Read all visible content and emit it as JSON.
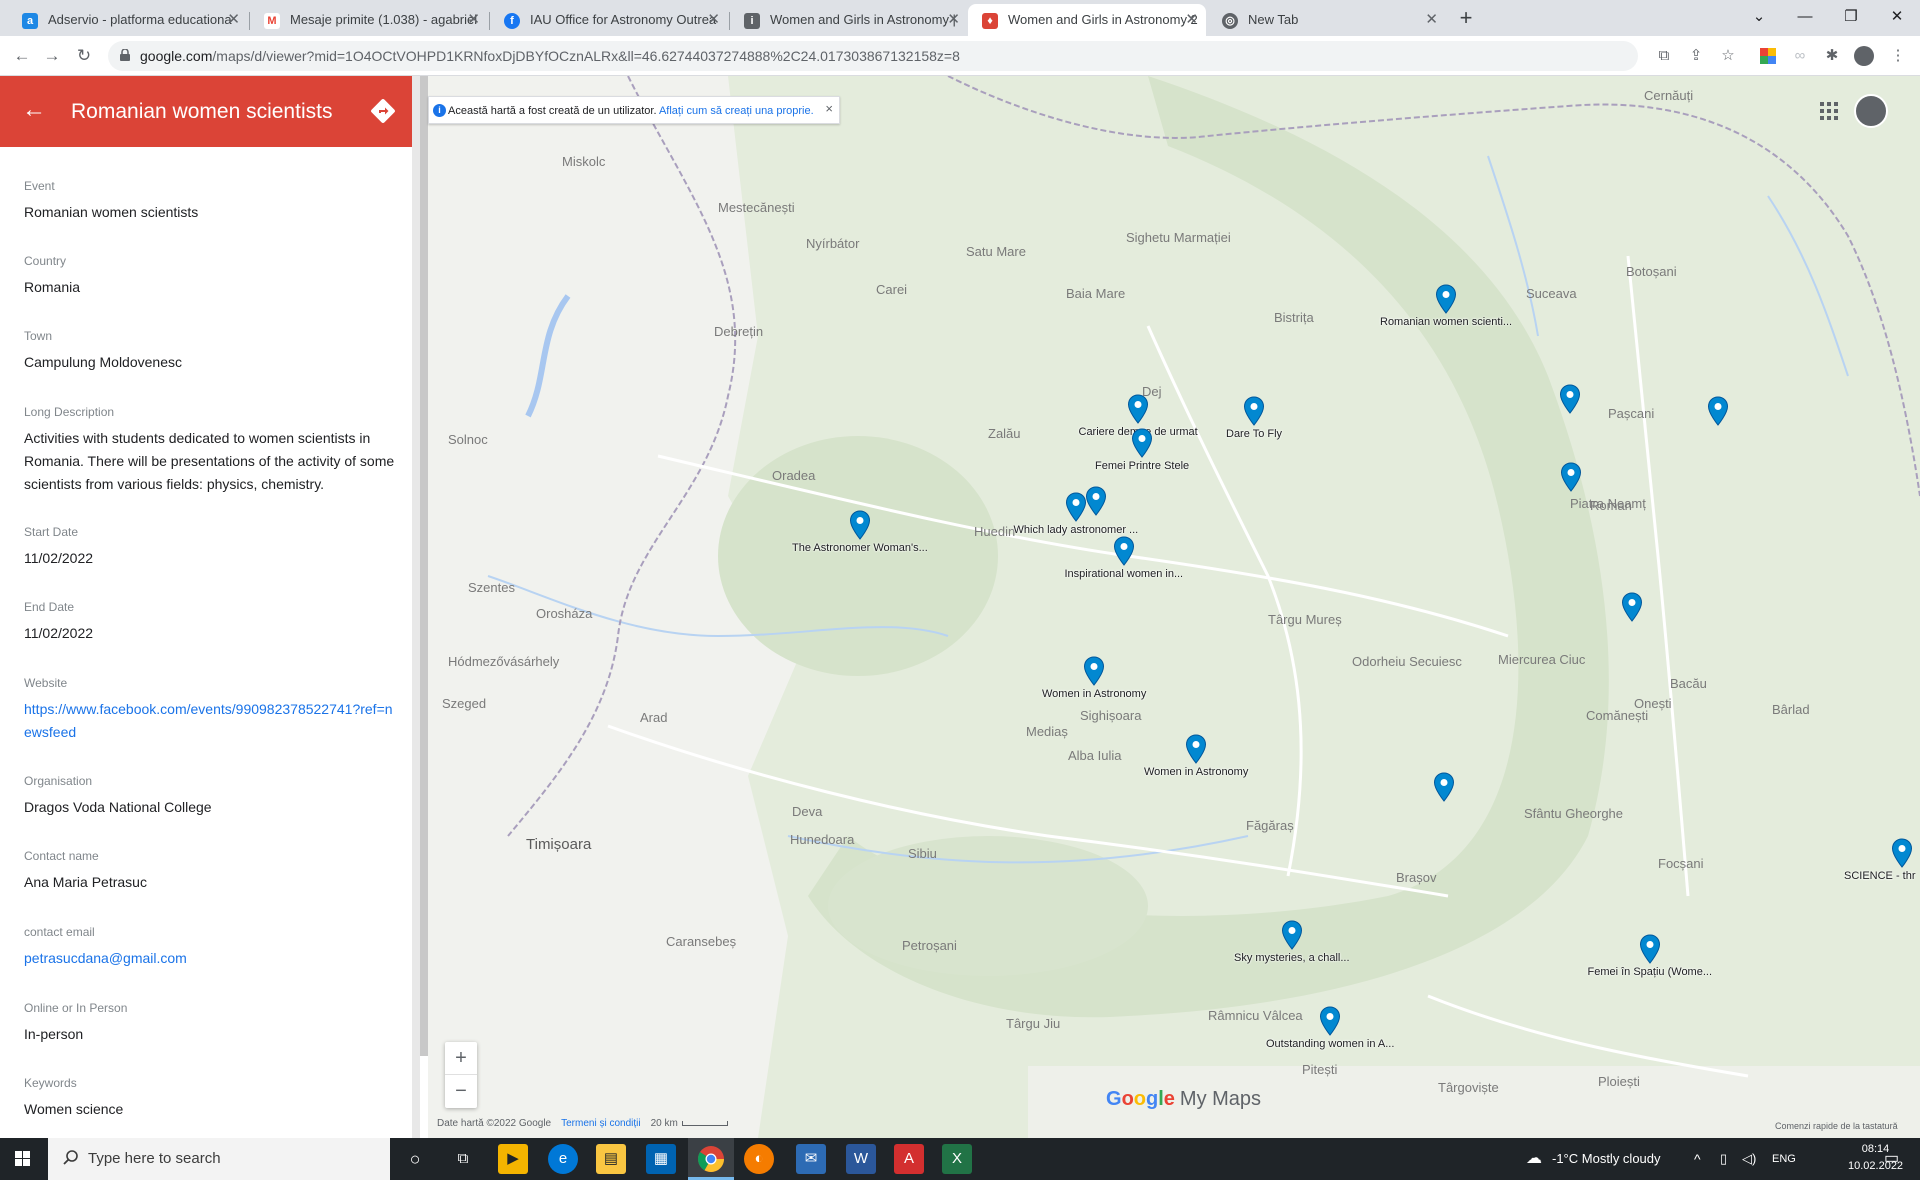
{
  "browser": {
    "tabs": [
      {
        "title": "Adservio - platforma educationa",
        "icon": "adservio-icon",
        "color": "#1e88e5"
      },
      {
        "title": "Mesaje primite (1.038) - agabriel",
        "icon": "gmail-icon",
        "color": "#ea4335"
      },
      {
        "title": "IAU Office for Astronomy Outrea",
        "icon": "facebook-icon",
        "color": "#1877f2"
      },
      {
        "title": "Women and Girls in Astronomy |",
        "icon": "iau-icon",
        "color": "#5f6368"
      },
      {
        "title": "Women and Girls in Astronomy 2",
        "icon": "mymaps-icon",
        "color": "#db4437"
      },
      {
        "title": "New Tab",
        "icon": "chrome-icon",
        "color": "#5f6368"
      }
    ],
    "url_host": "google.com",
    "url_path": "/maps/d/viewer?mid=1O4OCtVOHPD1KRNfoxDjDBYfOCznALRx&ll=46.62744037274888%2C24.017303867132158z=8"
  },
  "panel": {
    "title": "Romanian women scientists",
    "fields": [
      {
        "label": "Event",
        "value": "Romanian women scientists",
        "link": false
      },
      {
        "label": "Country",
        "value": "Romania",
        "link": false
      },
      {
        "label": "Town",
        "value": "Campulung Moldovenesc",
        "link": false
      },
      {
        "label": "Long Description",
        "value": "Activities with students dedicated to women scientists in Romania. There will be presentations of the activity of some scientists from various fields: physics, chemistry.",
        "link": false
      },
      {
        "label": "Start Date",
        "value": "11/02/2022",
        "link": false
      },
      {
        "label": "End Date",
        "value": "11/02/2022",
        "link": false
      },
      {
        "label": "Website",
        "value": "https://www.facebook.com/events/990982378522741?ref=newsfeed",
        "link": true
      },
      {
        "label": "Organisation",
        "value": "Dragos Voda National College",
        "link": false
      },
      {
        "label": "Contact name",
        "value": "Ana Maria Petrasuc",
        "link": false
      },
      {
        "label": "contact email",
        "value": "petrasucdana@gmail.com",
        "link": true
      },
      {
        "label": "Online or In Person",
        "value": "In-person",
        "link": false
      },
      {
        "label": "Keywords",
        "value": "Women science",
        "link": false
      }
    ]
  },
  "map": {
    "banner_text": "Această hartă a fost creată de un utilizator.",
    "banner_link": "Aflați cum să creați una proprie.",
    "places": [
      {
        "name": "Miskolc",
        "big": false
      },
      {
        "name": "Mestecănești",
        "big": false
      },
      {
        "name": "Satu Mare",
        "big": false
      },
      {
        "name": "Baia Mare",
        "big": false
      },
      {
        "name": "Sighetu Marmației",
        "big": false
      },
      {
        "name": "Suceava",
        "big": false
      },
      {
        "name": "Botoșani",
        "big": false
      },
      {
        "name": "Debrețin",
        "big": false
      },
      {
        "name": "Oradea",
        "big": false
      },
      {
        "name": "Zalău",
        "big": false
      },
      {
        "name": "Huedin",
        "big": false
      },
      {
        "name": "Târgu Mureș",
        "big": false
      },
      {
        "name": "Arad",
        "big": false
      },
      {
        "name": "Timișoara",
        "big": true
      },
      {
        "name": "Deva",
        "big": false
      },
      {
        "name": "Hunedoara",
        "big": false
      },
      {
        "name": "Sibiu",
        "big": false
      },
      {
        "name": "Mediaș",
        "big": false
      },
      {
        "name": "Sighișoara",
        "big": false
      },
      {
        "name": "Odorheiu Secuiesc",
        "big": false
      },
      {
        "name": "Bacău",
        "big": false
      },
      {
        "name": "Pașcani",
        "big": false
      },
      {
        "name": "Roman",
        "big": false
      },
      {
        "name": "Făgăraș",
        "big": false
      },
      {
        "name": "Brașov",
        "big": false
      },
      {
        "name": "Focșani",
        "big": false
      },
      {
        "name": "Ploiești",
        "big": false
      },
      {
        "name": "Târgoviște",
        "big": false
      },
      {
        "name": "Râmnicu Vâlcea",
        "big": false
      },
      {
        "name": "Pitești",
        "big": false
      },
      {
        "name": "Târgu Jiu",
        "big": false
      },
      {
        "name": "Petroșani",
        "big": false
      },
      {
        "name": "Caransebeș",
        "big": false
      },
      {
        "name": "Szentes",
        "big": false
      },
      {
        "name": "Hódmezővásárhely",
        "big": false
      },
      {
        "name": "Szeged",
        "big": false
      },
      {
        "name": "Solnoc",
        "big": false
      },
      {
        "name": "Orosháza",
        "big": false
      },
      {
        "name": "Carei",
        "big": false
      },
      {
        "name": "Nyírbátor",
        "big": false
      },
      {
        "name": "Bistrița",
        "big": false
      },
      {
        "name": "Piatra Neamț",
        "big": false
      },
      {
        "name": "Miercurea Ciuc",
        "big": false
      },
      {
        "name": "Sfântu Gheorghe",
        "big": false
      },
      {
        "name": "Comănești",
        "big": false
      },
      {
        "name": "Onești",
        "big": false
      },
      {
        "name": "Bârlad",
        "big": false
      },
      {
        "name": "Cernăuți",
        "big": false
      },
      {
        "name": "Dej",
        "big": false
      },
      {
        "name": "Alba Iulia",
        "big": false
      }
    ],
    "markers": [
      {
        "label": "Romanian women scienti..."
      },
      {
        "label": "Cariere demne de urmat"
      },
      {
        "label": "Dare To Fly"
      },
      {
        "label": "Femei Printre Stele"
      },
      {
        "label": "Which lady astronomer ..."
      },
      {
        "label": ""
      },
      {
        "label": "The Astronomer Woman's..."
      },
      {
        "label": "Inspirational women in..."
      },
      {
        "label": "Women in Astronomy"
      },
      {
        "label": "Women in Astronomy"
      },
      {
        "label": ""
      },
      {
        "label": ""
      },
      {
        "label": ""
      },
      {
        "label": ""
      },
      {
        "label": ""
      },
      {
        "label": "SCIENCE - thr"
      },
      {
        "label": "Femei în Spațiu (Wome..."
      },
      {
        "label": "Sky mysteries, a chall..."
      },
      {
        "label": "Outstanding women in A..."
      }
    ],
    "logo_google": "Google",
    "logo_mymaps": "My Maps",
    "attribution": "Date hartă ©2022 Google",
    "terms": "Termeni și condiții",
    "scale": "20 km",
    "shortcuts": "Comenzi rapide de la tastatură",
    "zoom_in": "+",
    "zoom_out": "−"
  },
  "taskbar": {
    "search_placeholder": "Type here to search",
    "weather": "-1°C  Mostly cloudy",
    "lang": "ENG",
    "time": "08:14",
    "date": "10.02.2022"
  }
}
